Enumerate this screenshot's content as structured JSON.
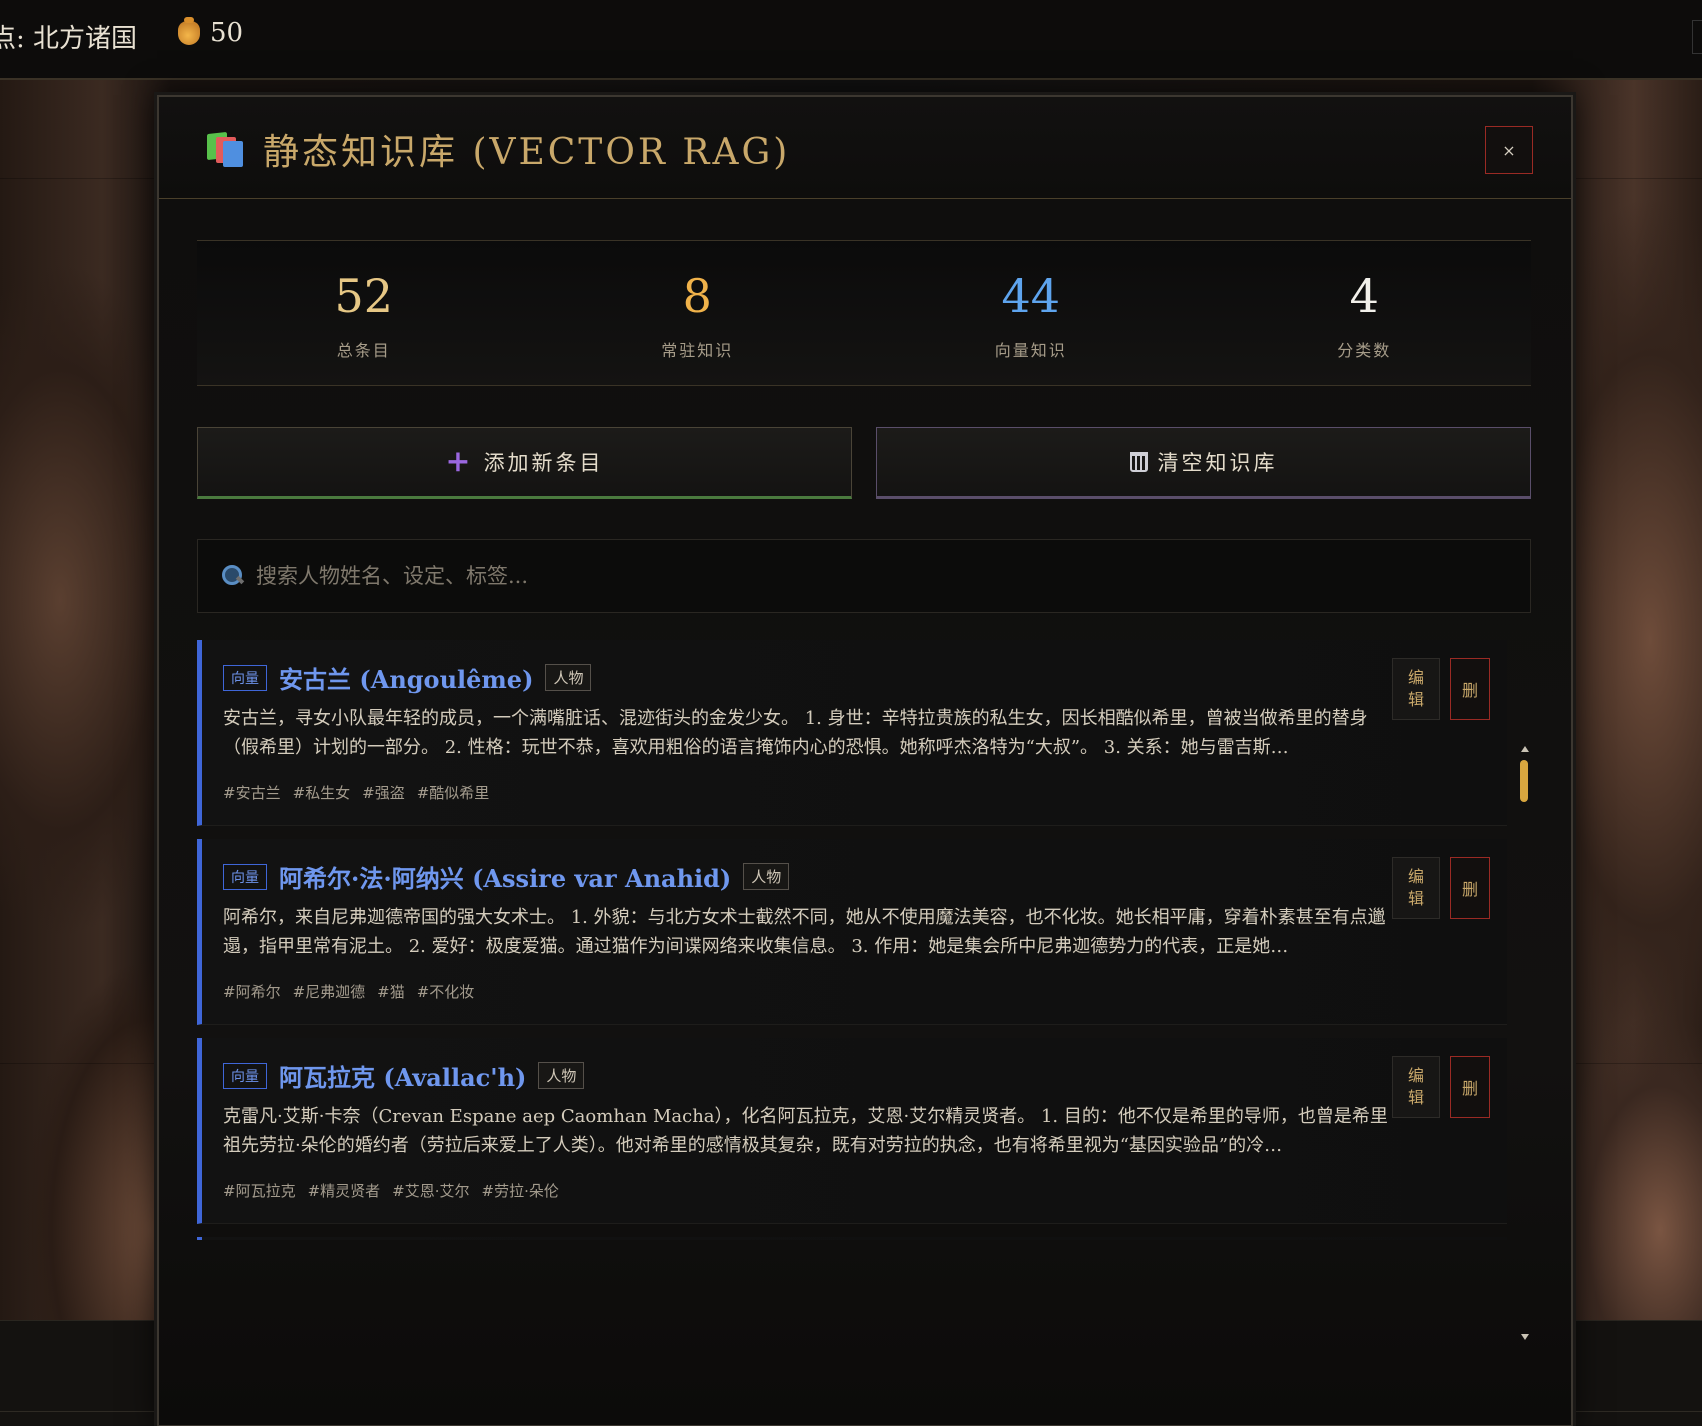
{
  "topbar": {
    "location": "点: 北方诸国",
    "gold": "50"
  },
  "modal": {
    "title": "静态知识库 (VECTOR RAG)",
    "close_label": "×"
  },
  "stats": [
    {
      "value": "52",
      "label": "总条目",
      "color": "#e6c785"
    },
    {
      "value": "8",
      "label": "常驻知识",
      "color": "#f0b24a"
    },
    {
      "value": "44",
      "label": "向量知识",
      "color": "#5ea4ee"
    },
    {
      "value": "4",
      "label": "分类数",
      "color": "#f2f0ea"
    }
  ],
  "actions": {
    "add_label": "添加新条目",
    "clear_label": "清空知识库"
  },
  "search": {
    "placeholder": "搜索人物姓名、设定、标签..."
  },
  "entries": [
    {
      "badge": "向量",
      "title": "安古兰 (Angoulême)",
      "category": "人物",
      "description": "安古兰，寻女小队最年轻的成员，一个满嘴脏话、混迹街头的金发少女。 1. 身世：辛特拉贵族的私生女，因长相酷似希里，曾被当做希里的替身（假希里）计划的一部分。 2. 性格：玩世不恭，喜欢用粗俗的语言掩饰内心的恐惧。她称呼杰洛特为“大叔”。 3. 关系：她与雷吉斯…",
      "tags": [
        "#安古兰",
        "#私生女",
        "#强盗",
        "#酷似希里"
      ],
      "edit_label": "编辑",
      "delete_label": "删"
    },
    {
      "badge": "向量",
      "title": "阿希尔·法·阿纳兴 (Assire var Anahid)",
      "category": "人物",
      "description": "阿希尔，来自尼弗迦德帝国的强大女术士。 1. 外貌：与北方女术士截然不同，她从不使用魔法美容，也不化妆。她长相平庸，穿着朴素甚至有点邋遢，指甲里常有泥土。 2. 爱好：极度爱猫。通过猫作为间谍网络来收集信息。 3. 作用：她是集会所中尼弗迦德势力的代表，正是她…",
      "tags": [
        "#阿希尔",
        "#尼弗迦德",
        "#猫",
        "#不化妆"
      ],
      "edit_label": "编辑",
      "delete_label": "删"
    },
    {
      "badge": "向量",
      "title": "阿瓦拉克 (Avallac'h)",
      "category": "人物",
      "description": "克雷凡·艾斯·卡奈（Crevan Espane aep Caomhan Macha），化名阿瓦拉克，艾恩·艾尔精灵贤者。 1. 目的：他不仅是希里的导师，也曾是希里祖先劳拉·朵伦的婚约者（劳拉后来爱上了人类）。他对希里的感情极其复杂，既有对劳拉的执念，也有将希里视为“基因实验品”的冷…",
      "tags": [
        "#阿瓦拉克",
        "#精灵贤者",
        "#艾恩·艾尔",
        "#劳拉·朵伦"
      ],
      "edit_label": "编辑",
      "delete_label": "删"
    }
  ]
}
